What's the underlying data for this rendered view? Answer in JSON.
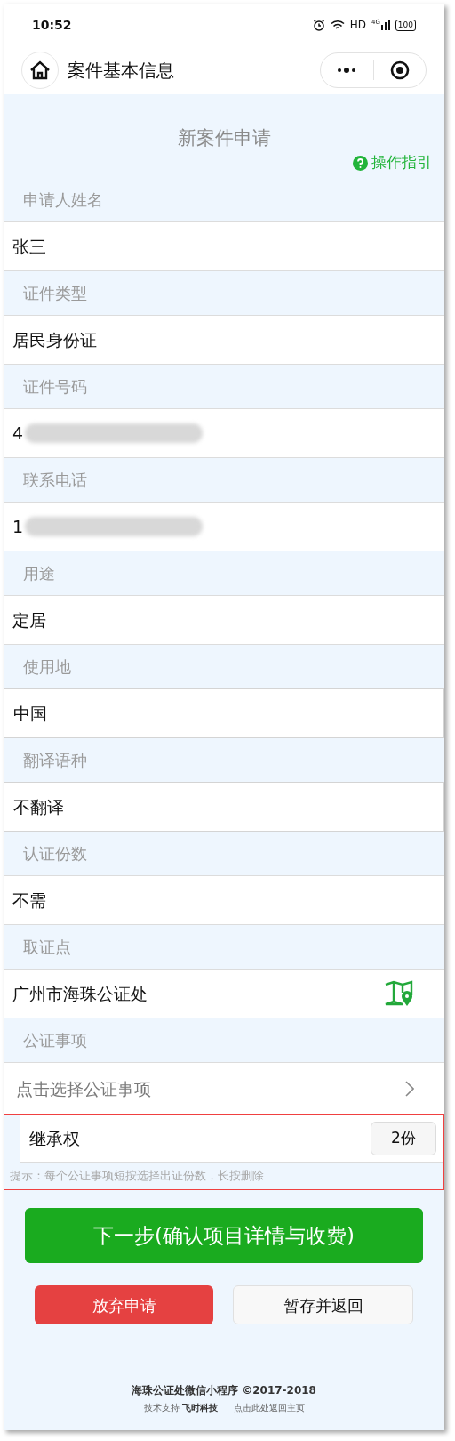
{
  "status_bar": {
    "time": "10:52",
    "network": "HD",
    "cellular": "4G",
    "battery": "100"
  },
  "nav_bar": {
    "title": "案件基本信息"
  },
  "form": {
    "title": "新案件申请",
    "guide_link": "操作指引",
    "fields": [
      {
        "label": "申请人姓名",
        "value": "张三",
        "kind": "text",
        "redacted": false
      },
      {
        "label": "证件类型",
        "value": "居民身份证",
        "kind": "text",
        "redacted": false
      },
      {
        "label": "证件号码",
        "value": "4",
        "kind": "text",
        "redacted": true
      },
      {
        "label": "联系电话",
        "value": "1",
        "kind": "text",
        "redacted": true
      },
      {
        "label": "用途",
        "value": "定居",
        "kind": "text",
        "redacted": false
      },
      {
        "label": "使用地",
        "value": "中国",
        "kind": "input",
        "redacted": false
      },
      {
        "label": "翻译语种",
        "value": "不翻译",
        "kind": "input",
        "redacted": false
      },
      {
        "label": "认证份数",
        "value": "不需",
        "kind": "text",
        "redacted": false
      },
      {
        "label": "取证点",
        "value": "广州市海珠公证处",
        "kind": "location",
        "redacted": false
      }
    ],
    "matters": {
      "label": "公证事项",
      "selector": "点击选择公证事项",
      "items": [
        {
          "name": "继承权",
          "copies": "2份"
        }
      ],
      "hint": "提示：每个公证事项短按选择出证份数，长按删除"
    }
  },
  "buttons": {
    "next": "下一步(确认项目详情与收费)",
    "abandon": "放弃申请",
    "save": "暂存并返回"
  },
  "footer": {
    "copyright": "海珠公证处微信小程序 ©2017-2018",
    "support_label": "技术支持",
    "support_name": "飞时科技",
    "home_link": "点击此处返回主页"
  }
}
